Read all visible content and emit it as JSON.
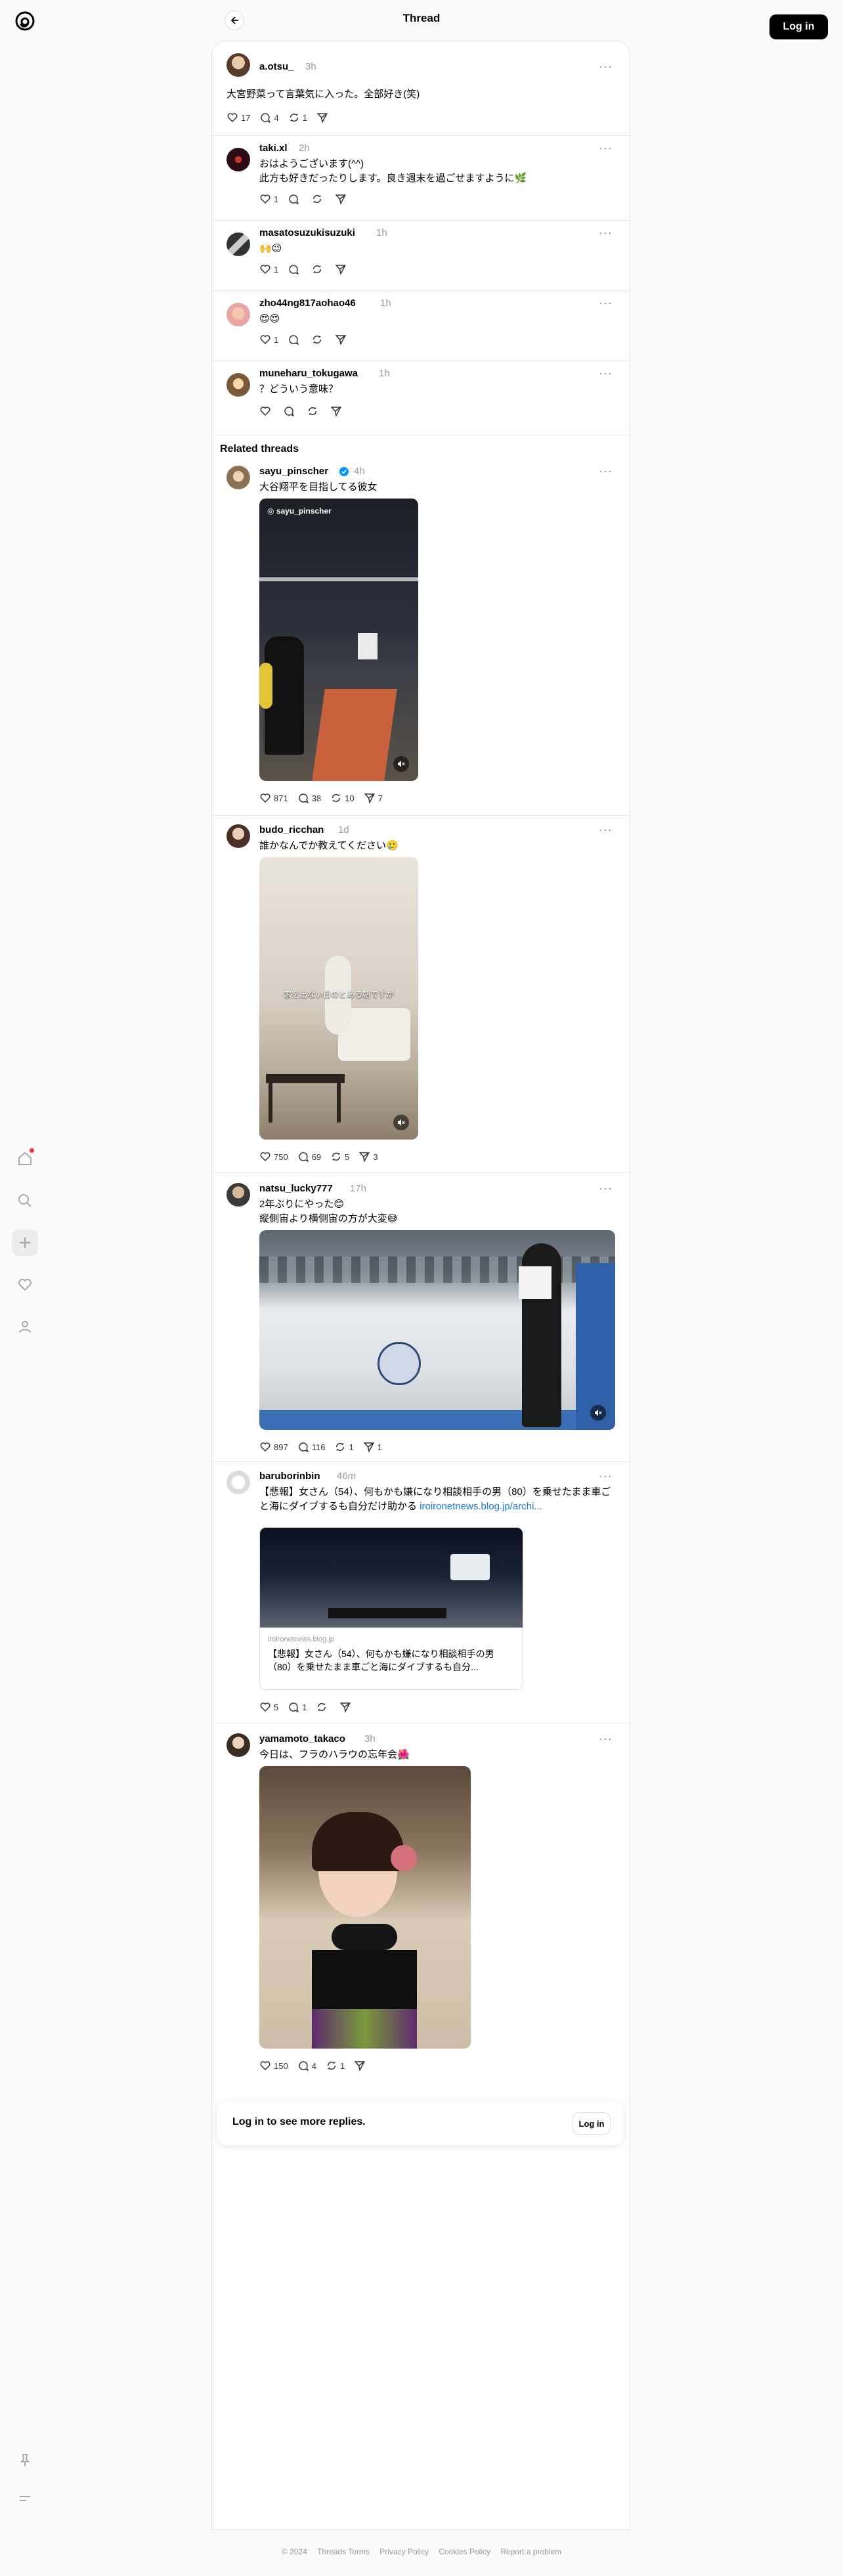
{
  "header": {
    "title": "Thread",
    "login_label": "Log in"
  },
  "posts": [
    {
      "username": "a.otsu_",
      "time": "3h",
      "text": "大宮野菜って言葉気に入った。全部好き(笑)",
      "likes": "17",
      "replies": "4",
      "reposts": "1"
    },
    {
      "username": "taki.xl",
      "time": "2h",
      "text": "おはようございます(^^)\n此方も好きだったりします。良き週末を過ごせますように🌿",
      "likes": "1"
    },
    {
      "username": "masatosuzukisuzuki",
      "time": "1h",
      "text": "🙌😉",
      "likes": "1"
    },
    {
      "username": "zho44ng817aohao46",
      "time": "1h",
      "text": "😍😍",
      "likes": "1"
    },
    {
      "username": "muneharu_tokugawa",
      "time": "1h",
      "text": "？どういう意味？"
    }
  ],
  "related_title": "Related threads",
  "related": [
    {
      "username": "sayu_pinscher",
      "time": "4h",
      "text": "大谷翔平を目指してる彼女",
      "media_label": "sayu_pinscher",
      "likes": "871",
      "replies": "38",
      "reposts": "10",
      "shares": "7"
    },
    {
      "username": "budo_ricchan",
      "time": "1d",
      "text": "誰かなんでか教えてください🥲",
      "media_caption": "家を出ない日のとある朝ですが",
      "likes": "750",
      "replies": "69",
      "reposts": "5",
      "shares": "3"
    },
    {
      "username": "natsu_lucky777",
      "time": "17h",
      "text": "2年ぶりにやった😊\n縦側宙より横側宙の方が大変😅",
      "likes": "897",
      "replies": "116",
      "reposts": "1",
      "shares": "1"
    },
    {
      "username": "baruborinbin",
      "time": "46m",
      "text": "【悲報】女さん（54）、何もかも嫌になり相談相手の男（80）を乗せたまま車ごと海にダイブするも自分だけ助かる ",
      "link": "iroironetnews.blog.jp/archi...",
      "link_domain": "iroironetnews.blog.jp",
      "link_title": "【悲報】女さん（54）、何もかも嫌になり相談相手の男（80）を乗せたまま車ごと海にダイブするも自分...",
      "likes": "5",
      "replies": "1"
    },
    {
      "username": "yamamoto_takaco",
      "time": "3h",
      "text": "今日は、フラのハラウの忘年会🌺",
      "likes": "150",
      "replies": "4",
      "reposts": "1"
    }
  ],
  "login_prompt": {
    "text": "Log in to see more replies.",
    "button": "Log in"
  },
  "footer": {
    "copyright": "© 2024",
    "terms": "Threads Terms",
    "privacy": "Privacy Policy",
    "cookies": "Cookies Policy",
    "report": "Report a problem"
  }
}
